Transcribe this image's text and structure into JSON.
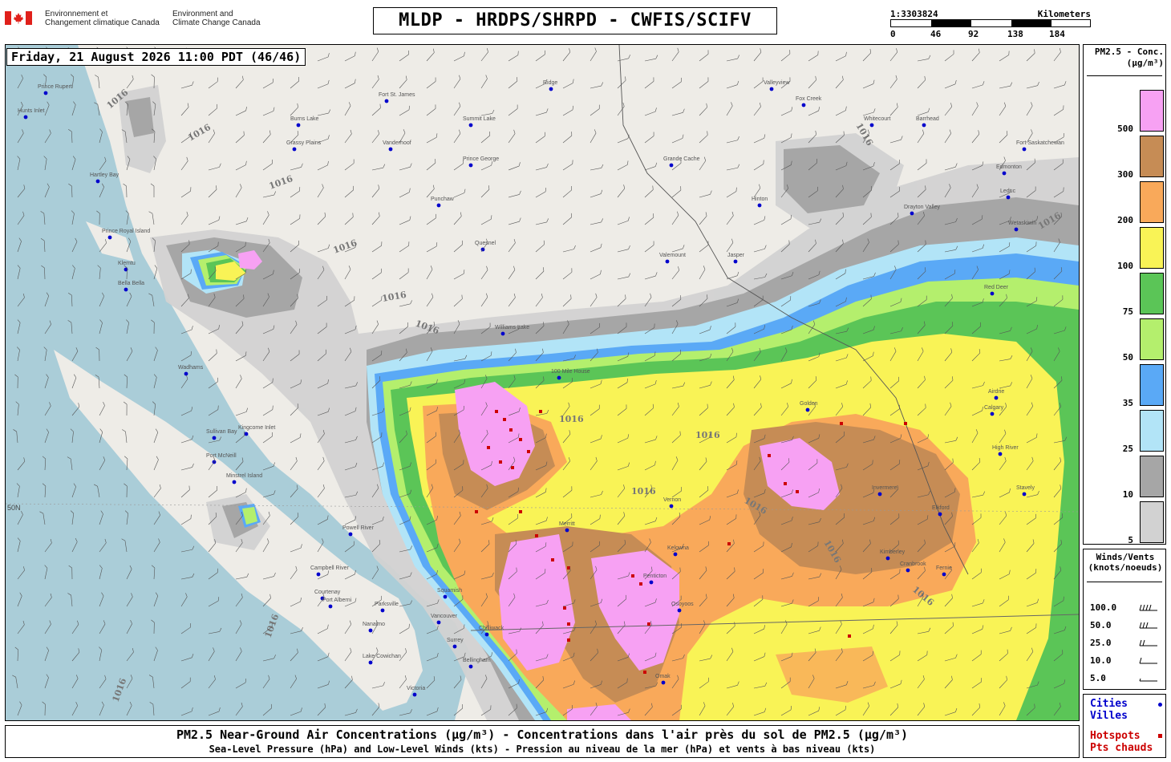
{
  "header": {
    "agency_fr": "Environnement et\nChangement climatique Canada",
    "agency_en": "Environment and\nClimate Change Canada",
    "title": "MLDP - HRDPS/SHRPD - CWFIS/SCIFV",
    "scale": {
      "ratio": "1:3303824",
      "unit": "Kilometers",
      "ticks": [
        "0",
        "46",
        "92",
        "138",
        "184"
      ]
    }
  },
  "timestamp": "Friday, 21 August 2026 11:00 PDT (46/46)",
  "legend_pm": {
    "title": "PM2.5 - Conc.\n(µg/m³)",
    "levels": [
      {
        "label": "500",
        "color": "#f7a1f3"
      },
      {
        "label": "300",
        "color": "#c68c55"
      },
      {
        "label": "200",
        "color": "#f9a95a"
      },
      {
        "label": "100",
        "color": "#f9f356"
      },
      {
        "label": "75",
        "color": "#5bc557"
      },
      {
        "label": "50",
        "color": "#b4ef6d"
      },
      {
        "label": "35",
        "color": "#5aa9f6"
      },
      {
        "label": "25",
        "color": "#b2e4f7"
      },
      {
        "label": "10",
        "color": "#a6a6a6"
      },
      {
        "label": "5",
        "color": "#d2d2d2"
      }
    ]
  },
  "legend_wind": {
    "title": "Winds/Vents\n(knots/noeuds)",
    "rows": [
      {
        "value": "100.0",
        "icon": "wind-barb-100-icon"
      },
      {
        "value": "50.0",
        "icon": "wind-barb-50-icon"
      },
      {
        "value": "25.0",
        "icon": "wind-barb-25-icon"
      },
      {
        "value": "10.0",
        "icon": "wind-barb-10-icon"
      },
      {
        "value": "5.0",
        "icon": "wind-barb-5-icon"
      }
    ]
  },
  "legend_symbols": {
    "cities": "Cities\nVilles",
    "cities_color": "#0000cc",
    "hotspots": "Hotspots\nPts chauds",
    "hotspots_color": "#cc0000"
  },
  "caption": {
    "line1": "PM2.5 Near-Ground Air Concentrations (µg/m³) - Concentrations dans l'air près du sol de PM2.5 (µg/m³)",
    "line2": "Sea-Level Pressure (hPa) and Low-Level Winds (kts) - Pression au niveau de la mer (hPa) et vents à bas niveau (kts)"
  },
  "map": {
    "isobar_label": "1016",
    "latitude_label": "50N",
    "cities": [
      "Prince Rupert",
      "Hunts Inlet",
      "Fort St. James",
      "Burns Lake",
      "Summit Lake",
      "Grassy Plains",
      "Prince George",
      "Vanderhoof",
      "Hartley Bay",
      "Grande Cache",
      "Punchaw",
      "Hinton",
      "Prince Royal Island",
      "Quesnel",
      "Valemount",
      "Jasper",
      "Klemtu",
      "Bella Bella",
      "Williams Lake",
      "100 Mile House",
      "Wadhams",
      "Sullivan Bay",
      "Kingcome Inlet",
      "Port McNeill",
      "Minstrel Island",
      "Merritt",
      "Vernon",
      "Kelowna",
      "Penticton",
      "Osoyoos",
      "Campbell River",
      "Courtenay",
      "Powell River",
      "Squamish",
      "Port Alberni",
      "Parksville",
      "Nanaimo",
      "Vancouver",
      "Surrey",
      "Chilliwack",
      "Bellingham",
      "Lake Cowichan",
      "Victoria",
      "Omak",
      "Golden",
      "Invermere",
      "Elkford",
      "Kimberley",
      "Cranbrook",
      "Fernie",
      "Calgary",
      "Airdrie",
      "High River",
      "Stavely",
      "Edmonton",
      "Leduc",
      "Wetaskiwin",
      "Red Deer",
      "Drayton Valley",
      "Whitecourt",
      "Barrhead",
      "Fox Creek",
      "Valleyview",
      "Ridge",
      "Fort Saskatchewan"
    ]
  }
}
